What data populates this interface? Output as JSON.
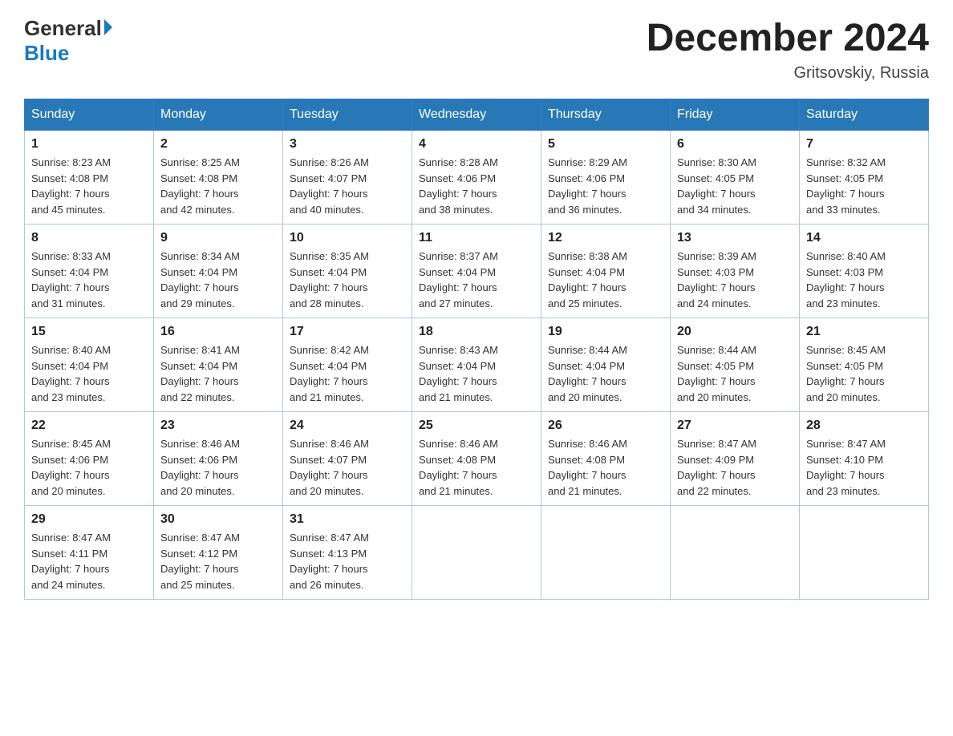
{
  "logo": {
    "general": "General",
    "blue": "Blue"
  },
  "header": {
    "title": "December 2024",
    "location": "Gritsovskiy, Russia"
  },
  "weekdays": [
    "Sunday",
    "Monday",
    "Tuesday",
    "Wednesday",
    "Thursday",
    "Friday",
    "Saturday"
  ],
  "weeks": [
    [
      {
        "num": "1",
        "sunrise": "8:23 AM",
        "sunset": "4:08 PM",
        "daylight": "7 hours and 45 minutes."
      },
      {
        "num": "2",
        "sunrise": "8:25 AM",
        "sunset": "4:08 PM",
        "daylight": "7 hours and 42 minutes."
      },
      {
        "num": "3",
        "sunrise": "8:26 AM",
        "sunset": "4:07 PM",
        "daylight": "7 hours and 40 minutes."
      },
      {
        "num": "4",
        "sunrise": "8:28 AM",
        "sunset": "4:06 PM",
        "daylight": "7 hours and 38 minutes."
      },
      {
        "num": "5",
        "sunrise": "8:29 AM",
        "sunset": "4:06 PM",
        "daylight": "7 hours and 36 minutes."
      },
      {
        "num": "6",
        "sunrise": "8:30 AM",
        "sunset": "4:05 PM",
        "daylight": "7 hours and 34 minutes."
      },
      {
        "num": "7",
        "sunrise": "8:32 AM",
        "sunset": "4:05 PM",
        "daylight": "7 hours and 33 minutes."
      }
    ],
    [
      {
        "num": "8",
        "sunrise": "8:33 AM",
        "sunset": "4:04 PM",
        "daylight": "7 hours and 31 minutes."
      },
      {
        "num": "9",
        "sunrise": "8:34 AM",
        "sunset": "4:04 PM",
        "daylight": "7 hours and 29 minutes."
      },
      {
        "num": "10",
        "sunrise": "8:35 AM",
        "sunset": "4:04 PM",
        "daylight": "7 hours and 28 minutes."
      },
      {
        "num": "11",
        "sunrise": "8:37 AM",
        "sunset": "4:04 PM",
        "daylight": "7 hours and 27 minutes."
      },
      {
        "num": "12",
        "sunrise": "8:38 AM",
        "sunset": "4:04 PM",
        "daylight": "7 hours and 25 minutes."
      },
      {
        "num": "13",
        "sunrise": "8:39 AM",
        "sunset": "4:03 PM",
        "daylight": "7 hours and 24 minutes."
      },
      {
        "num": "14",
        "sunrise": "8:40 AM",
        "sunset": "4:03 PM",
        "daylight": "7 hours and 23 minutes."
      }
    ],
    [
      {
        "num": "15",
        "sunrise": "8:40 AM",
        "sunset": "4:04 PM",
        "daylight": "7 hours and 23 minutes."
      },
      {
        "num": "16",
        "sunrise": "8:41 AM",
        "sunset": "4:04 PM",
        "daylight": "7 hours and 22 minutes."
      },
      {
        "num": "17",
        "sunrise": "8:42 AM",
        "sunset": "4:04 PM",
        "daylight": "7 hours and 21 minutes."
      },
      {
        "num": "18",
        "sunrise": "8:43 AM",
        "sunset": "4:04 PM",
        "daylight": "7 hours and 21 minutes."
      },
      {
        "num": "19",
        "sunrise": "8:44 AM",
        "sunset": "4:04 PM",
        "daylight": "7 hours and 20 minutes."
      },
      {
        "num": "20",
        "sunrise": "8:44 AM",
        "sunset": "4:05 PM",
        "daylight": "7 hours and 20 minutes."
      },
      {
        "num": "21",
        "sunrise": "8:45 AM",
        "sunset": "4:05 PM",
        "daylight": "7 hours and 20 minutes."
      }
    ],
    [
      {
        "num": "22",
        "sunrise": "8:45 AM",
        "sunset": "4:06 PM",
        "daylight": "7 hours and 20 minutes."
      },
      {
        "num": "23",
        "sunrise": "8:46 AM",
        "sunset": "4:06 PM",
        "daylight": "7 hours and 20 minutes."
      },
      {
        "num": "24",
        "sunrise": "8:46 AM",
        "sunset": "4:07 PM",
        "daylight": "7 hours and 20 minutes."
      },
      {
        "num": "25",
        "sunrise": "8:46 AM",
        "sunset": "4:08 PM",
        "daylight": "7 hours and 21 minutes."
      },
      {
        "num": "26",
        "sunrise": "8:46 AM",
        "sunset": "4:08 PM",
        "daylight": "7 hours and 21 minutes."
      },
      {
        "num": "27",
        "sunrise": "8:47 AM",
        "sunset": "4:09 PM",
        "daylight": "7 hours and 22 minutes."
      },
      {
        "num": "28",
        "sunrise": "8:47 AM",
        "sunset": "4:10 PM",
        "daylight": "7 hours and 23 minutes."
      }
    ],
    [
      {
        "num": "29",
        "sunrise": "8:47 AM",
        "sunset": "4:11 PM",
        "daylight": "7 hours and 24 minutes."
      },
      {
        "num": "30",
        "sunrise": "8:47 AM",
        "sunset": "4:12 PM",
        "daylight": "7 hours and 25 minutes."
      },
      {
        "num": "31",
        "sunrise": "8:47 AM",
        "sunset": "4:13 PM",
        "daylight": "7 hours and 26 minutes."
      },
      null,
      null,
      null,
      null
    ]
  ],
  "labels": {
    "sunrise": "Sunrise:",
    "sunset": "Sunset:",
    "daylight": "Daylight:"
  }
}
